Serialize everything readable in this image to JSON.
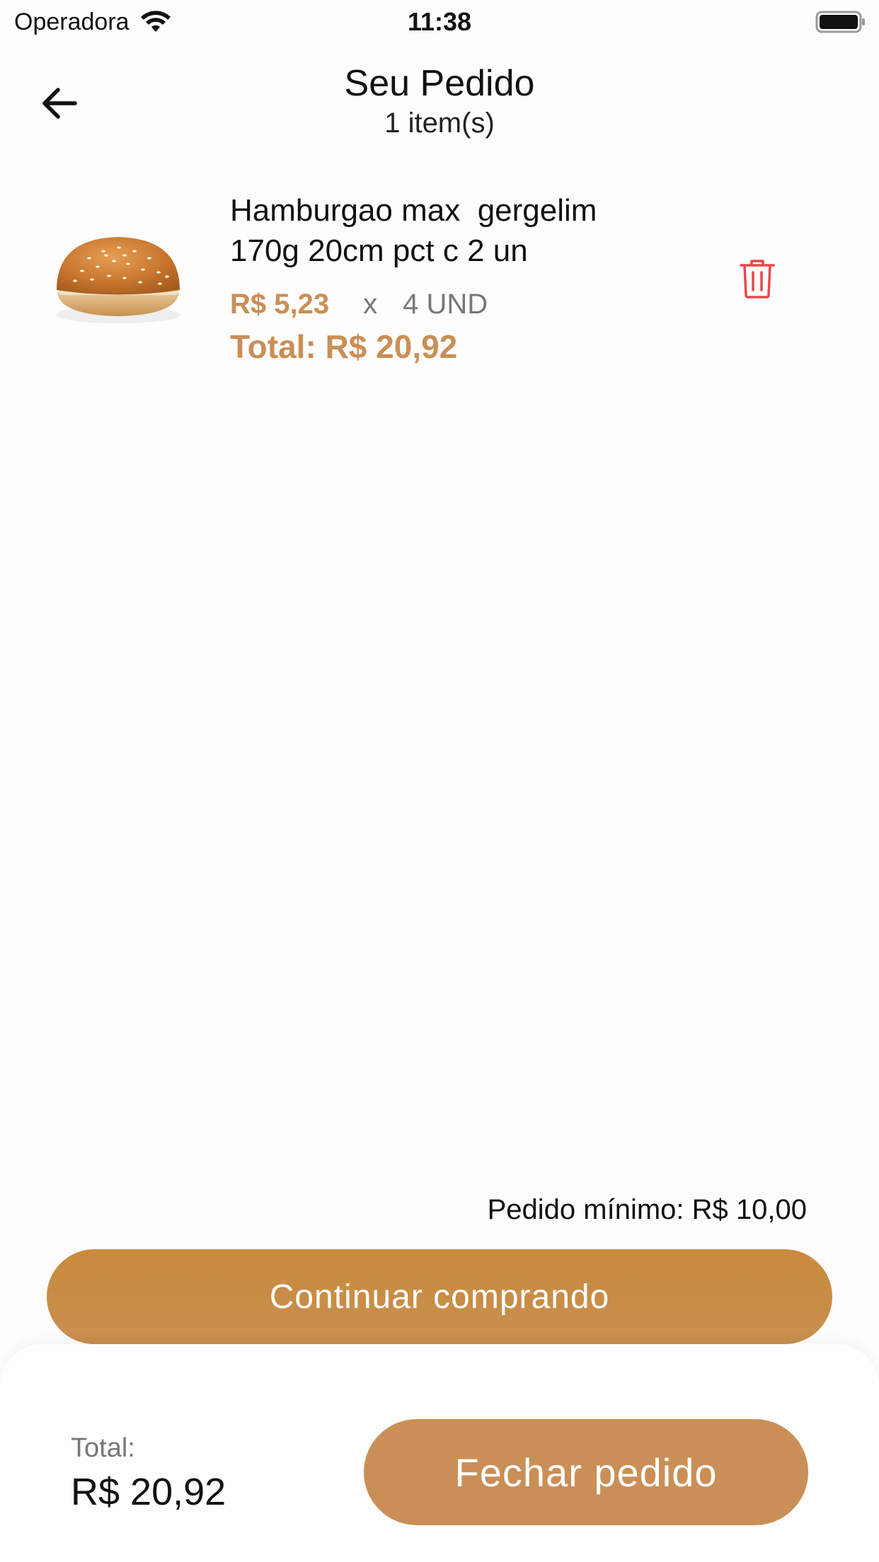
{
  "status_bar": {
    "carrier": "Operadora",
    "time": "11:38",
    "wifi_icon": "wifi-icon",
    "battery_icon": "battery-full-icon"
  },
  "header": {
    "back_icon": "arrow-left-icon",
    "title": "Seu Pedido",
    "subtitle": "1 item(s)"
  },
  "cart": {
    "items": [
      {
        "name": "Hamburgao max  gergelim\n170g 20cm pct c 2 un",
        "image_icon": "hamburger-bun-image",
        "unit_price": "R$ 5,23",
        "times": "x",
        "quantity": "4 UND",
        "total": "Total: R$ 20,92",
        "delete_icon": "trash-icon"
      }
    ]
  },
  "minimum_order": "Pedido mínimo: R$ 10,00",
  "continue_button": "Continuar comprando",
  "footer": {
    "total_label": "Total:",
    "total_value": "R$ 20,92",
    "checkout_button": "Fechar pedido"
  },
  "colors": {
    "accent": "#c98f56",
    "continue_button": "#c98a3c",
    "delete": "#e5484d"
  }
}
